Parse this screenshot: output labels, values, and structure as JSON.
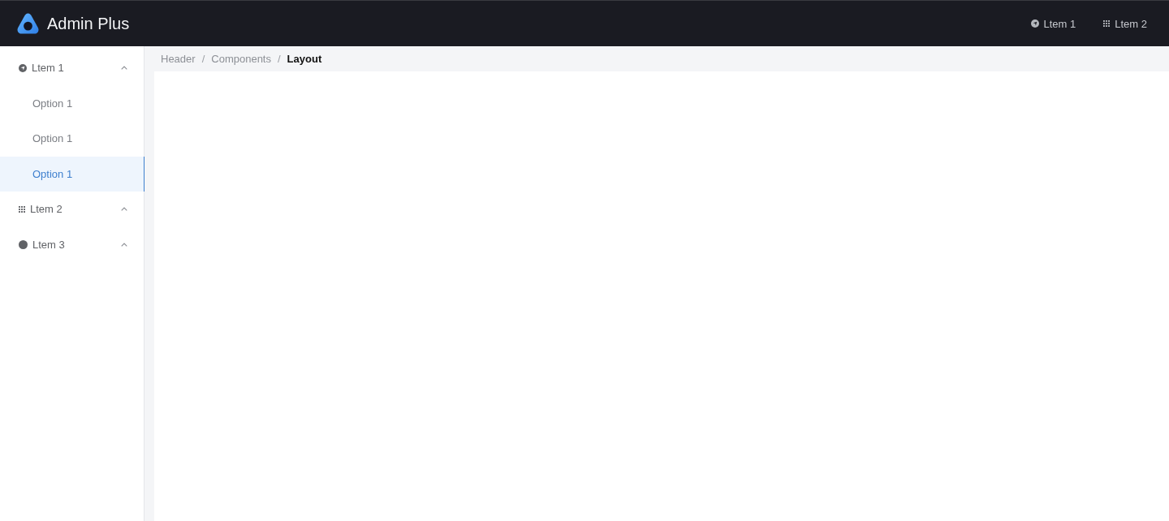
{
  "header": {
    "app_name": "Admin Plus",
    "nav_items": [
      {
        "label": "Ltem 1",
        "kind": "navigation"
      },
      {
        "label": "Ltem 2",
        "kind": "grid"
      }
    ]
  },
  "sidebar": {
    "groups": [
      {
        "label": "Ltem 1",
        "kind": "navigation",
        "children": [
          {
            "label": "Option 1",
            "selected": false
          },
          {
            "label": "Option 1",
            "selected": false
          },
          {
            "label": "Option 1",
            "selected": true
          }
        ]
      },
      {
        "label": "Ltem 2",
        "kind": "grid"
      },
      {
        "label": "Ltem 3",
        "kind": "dot"
      }
    ]
  },
  "breadcrumb": [
    {
      "kind": "link",
      "label": "Header"
    },
    {
      "kind": "separator",
      "label": "/"
    },
    {
      "kind": "link",
      "label": "Components"
    },
    {
      "kind": "separator",
      "label": "/"
    },
    {
      "kind": "current",
      "label": "Layout"
    }
  ]
}
